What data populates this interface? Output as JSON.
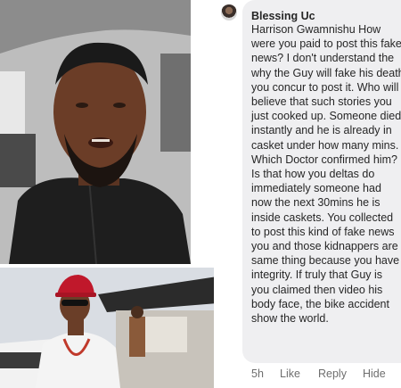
{
  "comment": {
    "author": "Blessing Uc",
    "lines": [
      "Harrison Gwamnishu How",
      "were you paid to post this fake",
      "news? I don't understand the",
      "why the Guy will fake his death",
      "you concur to post it. Who will",
      "believe that such stories you",
      "just cooked up. Someone died",
      "instantly and he is already in",
      "casket under how many mins.",
      "Which Doctor confirmed him?",
      "Is that how you deltas do",
      "immediately someone had",
      "now the next 30mins he is",
      "inside caskets. You collected",
      "to post this kind of fake news",
      "you and those kidnappers are",
      "same thing because you have no",
      "integrity. If truly that Guy is",
      "you claimed then video his",
      "body face, the bike accident",
      "show the world."
    ],
    "actions": {
      "time": "5h",
      "like": "Like",
      "reply": "Reply",
      "hide": "Hide"
    }
  }
}
